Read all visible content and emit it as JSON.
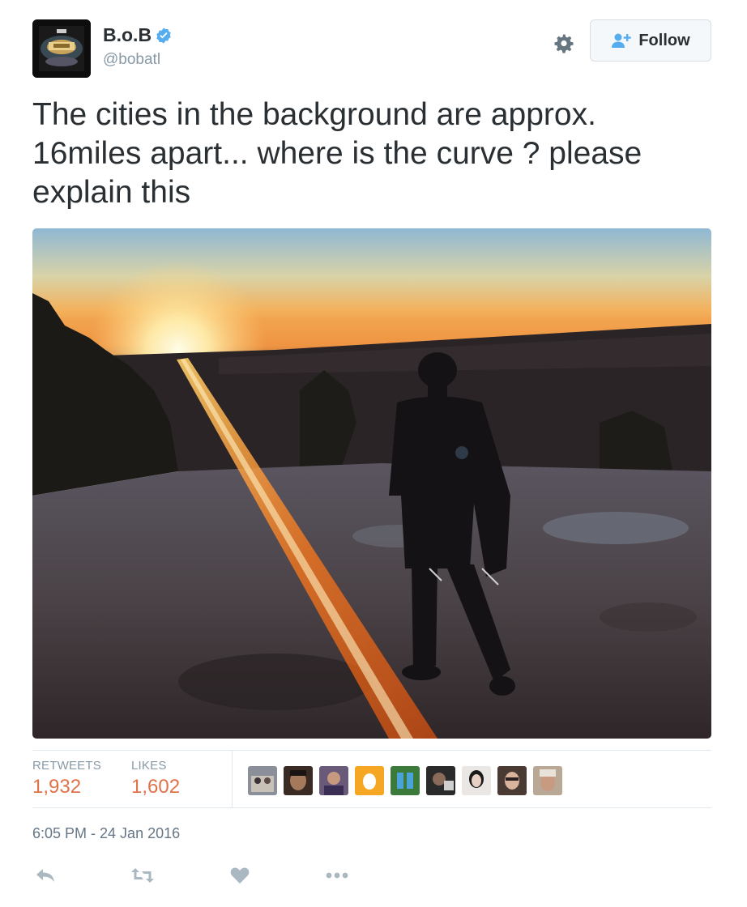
{
  "user": {
    "display_name": "B.o.B",
    "handle": "@bobatl",
    "verified": true,
    "avatar_icon": "album-cover-avatar"
  },
  "follow_button": {
    "label": "Follow",
    "icon": "add-user-icon"
  },
  "settings_icon": "gear-icon",
  "tweet": {
    "text": "The cities in the background are approx. 16miles apart... where is the curve ? please explain this"
  },
  "photo": {
    "subject": "photo"
  },
  "stats": {
    "retweets_label": "RETWEETS",
    "retweets_value": "1,932",
    "likes_label": "LIKES",
    "likes_value": "1,602"
  },
  "likers_count_shown": 9,
  "timestamp": "6:05 PM - 24 Jan 2016",
  "actions": [
    "reply-icon",
    "retweet-icon",
    "like-icon",
    "more-icon"
  ],
  "colors": {
    "text": "#292f33",
    "muted": "#8899a6",
    "stat_value": "#e0724a",
    "verified": "#55acee",
    "border": "#e1e8ed"
  }
}
